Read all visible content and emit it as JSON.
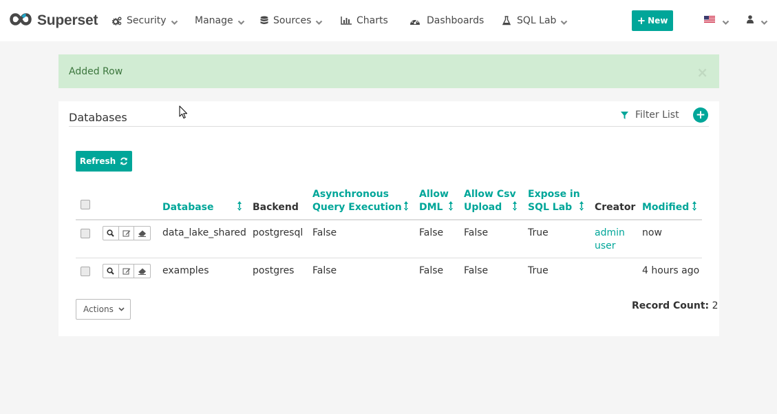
{
  "navbar": {
    "brand": "Superset",
    "items": [
      {
        "label": "Security",
        "icon": "cogs-icon",
        "dropdown": true
      },
      {
        "label": "Manage",
        "icon": "",
        "dropdown": true
      },
      {
        "label": "Sources",
        "icon": "database-icon",
        "dropdown": true
      },
      {
        "label": "Charts",
        "icon": "bar-chart-icon",
        "dropdown": false
      },
      {
        "label": "Dashboards",
        "icon": "dashboard-icon",
        "dropdown": false
      },
      {
        "label": "SQL Lab",
        "icon": "flask-icon",
        "dropdown": true
      }
    ],
    "new_button": "New",
    "language_icon": "us-flag-icon",
    "user_icon": "user-icon"
  },
  "alert": {
    "message": "Added Row",
    "close": "×"
  },
  "panel": {
    "title": "Databases",
    "filter_label": "Filter List",
    "add_label": "+",
    "refresh_label": "Refresh"
  },
  "table": {
    "columns": [
      {
        "label": "Database",
        "sortable": true
      },
      {
        "label": "Backend",
        "sortable": false
      },
      {
        "label": "Asynchronous Query Execution",
        "line1": "Asynchronous",
        "line2": "Query Execution",
        "sortable": true
      },
      {
        "label": "Allow DML",
        "line1": "Allow",
        "line2": "DML",
        "sortable": true
      },
      {
        "label": "Allow Csv Upload",
        "line1": "Allow Csv",
        "line2": "Upload",
        "sortable": true
      },
      {
        "label": "Expose in SQL Lab",
        "line1": "Expose in",
        "line2": "SQL Lab",
        "sortable": true
      },
      {
        "label": "Creator",
        "sortable": false
      },
      {
        "label": "Modified",
        "sortable": true
      }
    ],
    "rows": [
      {
        "database": "data_lake_shared",
        "backend": "postgresql",
        "async": "False",
        "allow_dml": "False",
        "allow_csv": "False",
        "expose": "True",
        "creator_line1": "admin",
        "creator_line2": "user",
        "modified": "now"
      },
      {
        "database": "examples",
        "backend": "postgres",
        "async": "False",
        "allow_dml": "False",
        "allow_csv": "False",
        "expose": "True",
        "creator_line1": "",
        "creator_line2": "",
        "modified": "4 hours ago"
      }
    ]
  },
  "footer": {
    "actions_label": "Actions",
    "record_count_label": "Record Count:",
    "record_count": "2"
  },
  "colors": {
    "accent": "#00a699",
    "alert_bg": "#d1ecd3",
    "alert_text": "#3c763d"
  }
}
